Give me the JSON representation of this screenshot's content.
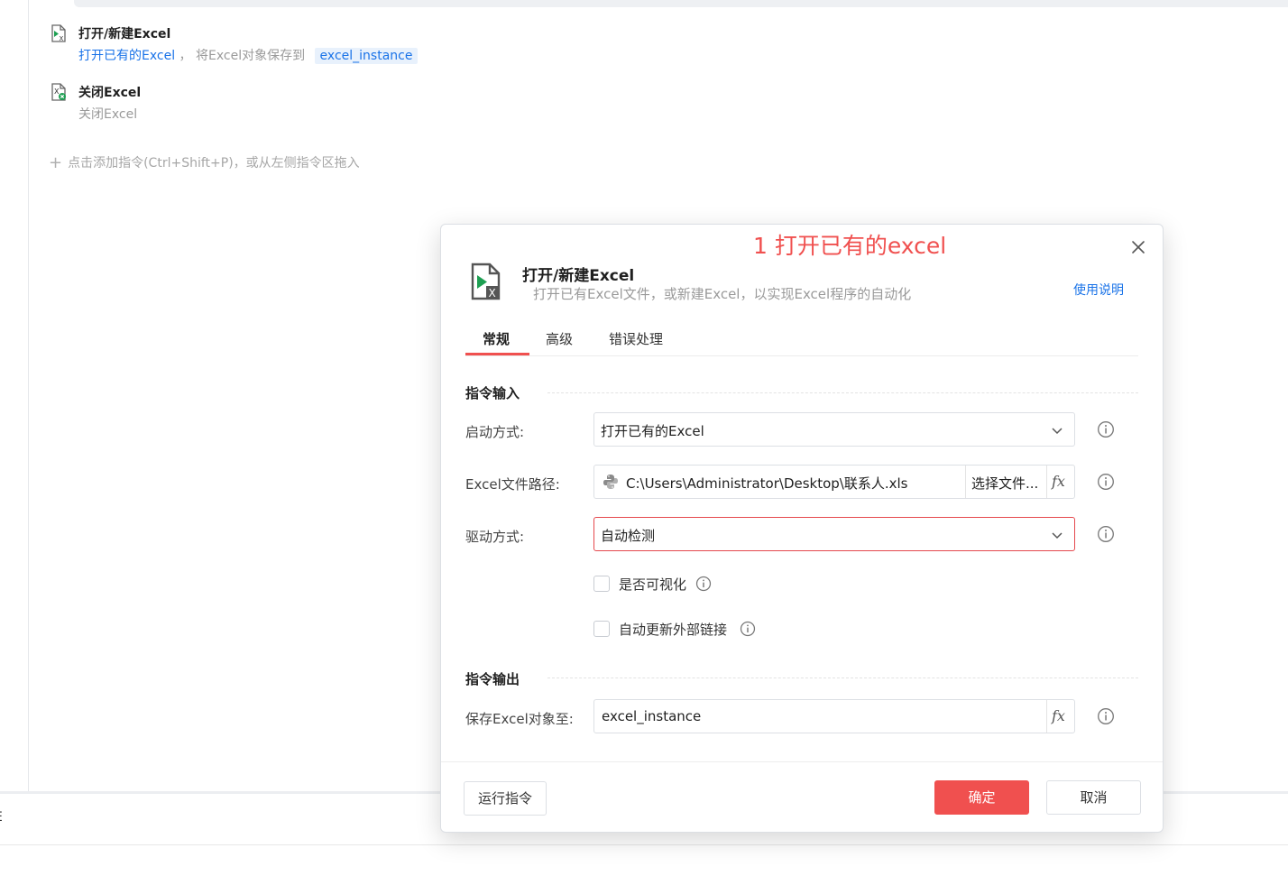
{
  "editor": {
    "commands": [
      {
        "title": "打开/新建Excel",
        "desc_mode": "打开已有的Excel",
        "desc_mid": "，  将Excel对象保存到",
        "desc_var": "excel_instance",
        "icon": "excel-open-icon"
      },
      {
        "title": "关闭Excel",
        "desc": "关闭Excel",
        "icon": "excel-close-icon"
      }
    ],
    "add_hint": "点击添加指令(Ctrl+Shift+P)，或从左侧指令区拖入",
    "bottom_panel_text": "E"
  },
  "dialog": {
    "annotation": "1 打开已有的excel",
    "title": "打开/新建Excel",
    "subtitle": "打开已有Excel文件，或新建Excel，以实现Excel程序的自动化",
    "help_link": "使用说明",
    "tabs": [
      "常规",
      "高级",
      "错误处理"
    ],
    "active_tab": "常规",
    "input_section": "指令输入",
    "output_section": "指令输出",
    "fields": {
      "launch_mode": {
        "label": "启动方式:",
        "value": "打开已有的Excel"
      },
      "file_path": {
        "label": "Excel文件路径:",
        "value": "C:\\Users\\Administrator\\Desktop\\联系人.xls",
        "button": "选择文件..."
      },
      "driver": {
        "label": "驱动方式:",
        "value": "自动检测"
      },
      "visible": {
        "label": "是否可视化",
        "checked": false
      },
      "update_links": {
        "label": "自动更新外部链接",
        "checked": false
      },
      "save_to": {
        "label": "保存Excel对象至:",
        "value": "excel_instance"
      }
    },
    "fx_label": "fx",
    "buttons": {
      "run": "运行指令",
      "ok": "确定",
      "cancel": "取消"
    }
  },
  "colors": {
    "accent_red": "#f0504f",
    "link_blue": "#1a73e8",
    "excel_green": "#1d9f52"
  }
}
